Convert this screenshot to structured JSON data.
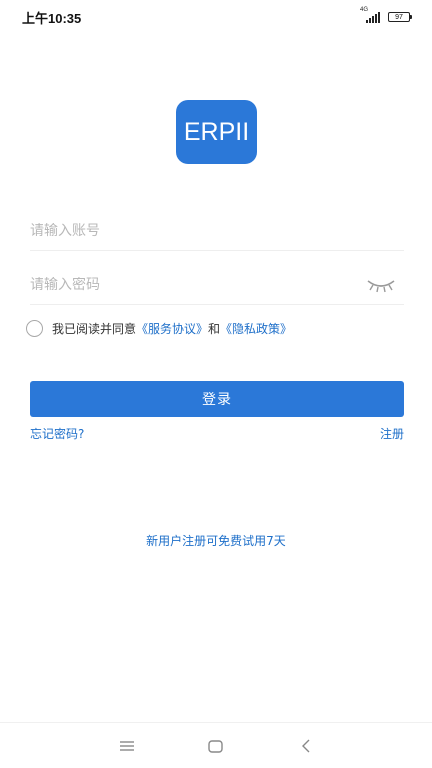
{
  "status_bar": {
    "time": "上午10:35",
    "network": "4G",
    "battery": "97"
  },
  "logo": {
    "text": "ERPII",
    "color": "#2b78d8"
  },
  "login_form": {
    "account_placeholder": "请输入账号",
    "password_placeholder": "请输入密码",
    "agreement_prefix": "我已阅读并同意",
    "service_agreement": "《服务协议》",
    "agreement_and": "和",
    "privacy_policy": "《隐私政策》",
    "login_button": "登录",
    "forgot_password": "忘记密码?",
    "register": "注册"
  },
  "promo_text": "新用户注册可免费试用7天",
  "colors": {
    "accent": "#2b78d8",
    "link": "#1e6fc9"
  },
  "nav_bar": {
    "icons": [
      "menu-icon",
      "home-icon",
      "back-icon"
    ]
  }
}
